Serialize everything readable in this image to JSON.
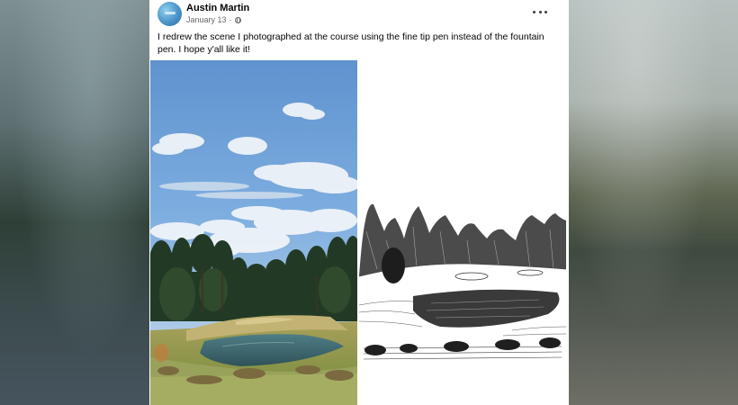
{
  "post": {
    "author": "Austin Martin",
    "date": "January 13",
    "separator": "·",
    "audience_icon": "globe-icon",
    "more_icon": "more-horizontal-icon",
    "text": "I redrew the scene I photographed at the course using the fine tip pen instead of the fountain pen. I hope y'all like it!"
  },
  "photos": [
    {
      "kind": "photograph",
      "subject": "golf-course-pond"
    },
    {
      "kind": "pen-drawing",
      "subject": "golf-course-pond"
    }
  ],
  "colors": {
    "text_primary": "#050505",
    "text_secondary": "#65676b",
    "card_bg": "#ffffff",
    "sky": "#6f9fd2",
    "grass": "#8c9a4e"
  }
}
